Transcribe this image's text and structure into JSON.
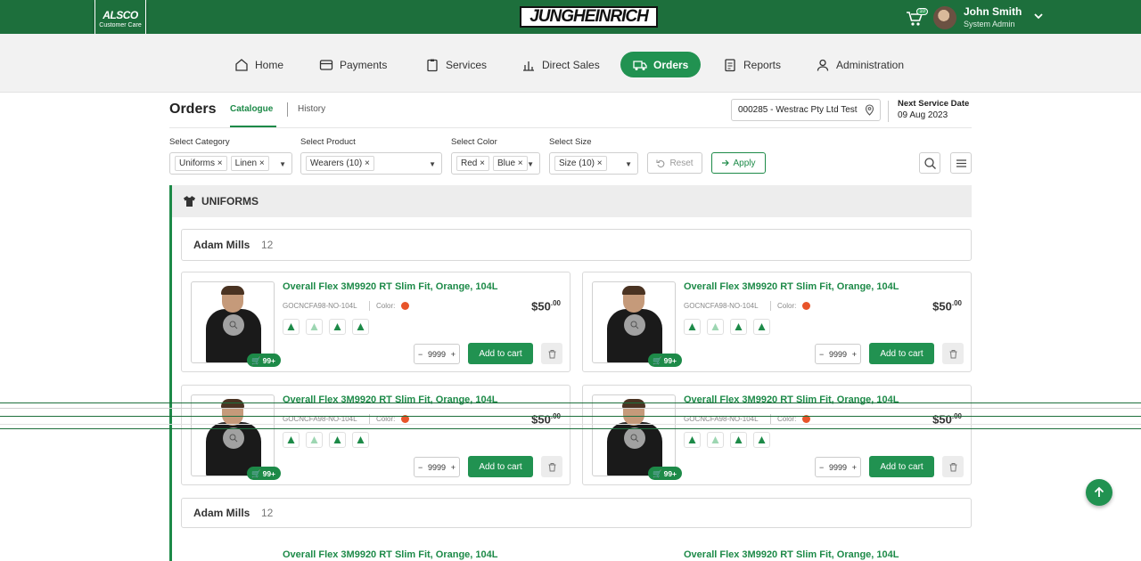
{
  "header": {
    "logo_brand": "ALSCO",
    "logo_sub": "Customer Care",
    "center_brand": "JUNGHEINRICH",
    "cart_count": "10",
    "user_name": "John Smith",
    "user_role": "System Admin"
  },
  "nav": {
    "items": [
      {
        "label": "Home",
        "icon": "home-icon"
      },
      {
        "label": "Payments",
        "icon": "wallet-icon"
      },
      {
        "label": "Services",
        "icon": "clipboard-icon"
      },
      {
        "label": "Direct Sales",
        "icon": "bar-chart-icon"
      },
      {
        "label": "Orders",
        "icon": "truck-icon",
        "active": true
      },
      {
        "label": "Reports",
        "icon": "report-icon"
      },
      {
        "label": "Administration",
        "icon": "user-icon"
      }
    ]
  },
  "page": {
    "title": "Orders",
    "tabs": [
      "Catalogue",
      "History"
    ],
    "account": "000285 - Westrac Pty Ltd Test",
    "next_service_label": "Next Service Date",
    "next_service_value": "09 Aug 2023"
  },
  "filters": {
    "category": {
      "label": "Select Category",
      "chips": [
        "Uniforms",
        "Linen"
      ]
    },
    "product": {
      "label": "Select Product",
      "chips": [
        "Wearers (10)"
      ]
    },
    "color": {
      "label": "Select Color",
      "chips": [
        "Red",
        "Blue"
      ]
    },
    "size": {
      "label": "Select Size",
      "chips": [
        "Size (10)"
      ]
    },
    "reset_label": "Reset",
    "apply_label": "Apply"
  },
  "section": {
    "category_title": "UNIFORMS",
    "group_name": "Adam Mills",
    "group_count": "12"
  },
  "product": {
    "title": "Overall Flex 3M9920 RT Slim Fit, Orange, 104L",
    "sku": "GOCNCFA98-NO-104L",
    "color_label": "Color:",
    "color_hex": "#e8542a",
    "price_main": "$50",
    "price_cents": ".00",
    "stock_badge": "99+",
    "quantity": "9999",
    "add_label": "Add to cart"
  },
  "colors": {
    "brand_green": "#1d6f3c",
    "accent_green": "#219251"
  }
}
